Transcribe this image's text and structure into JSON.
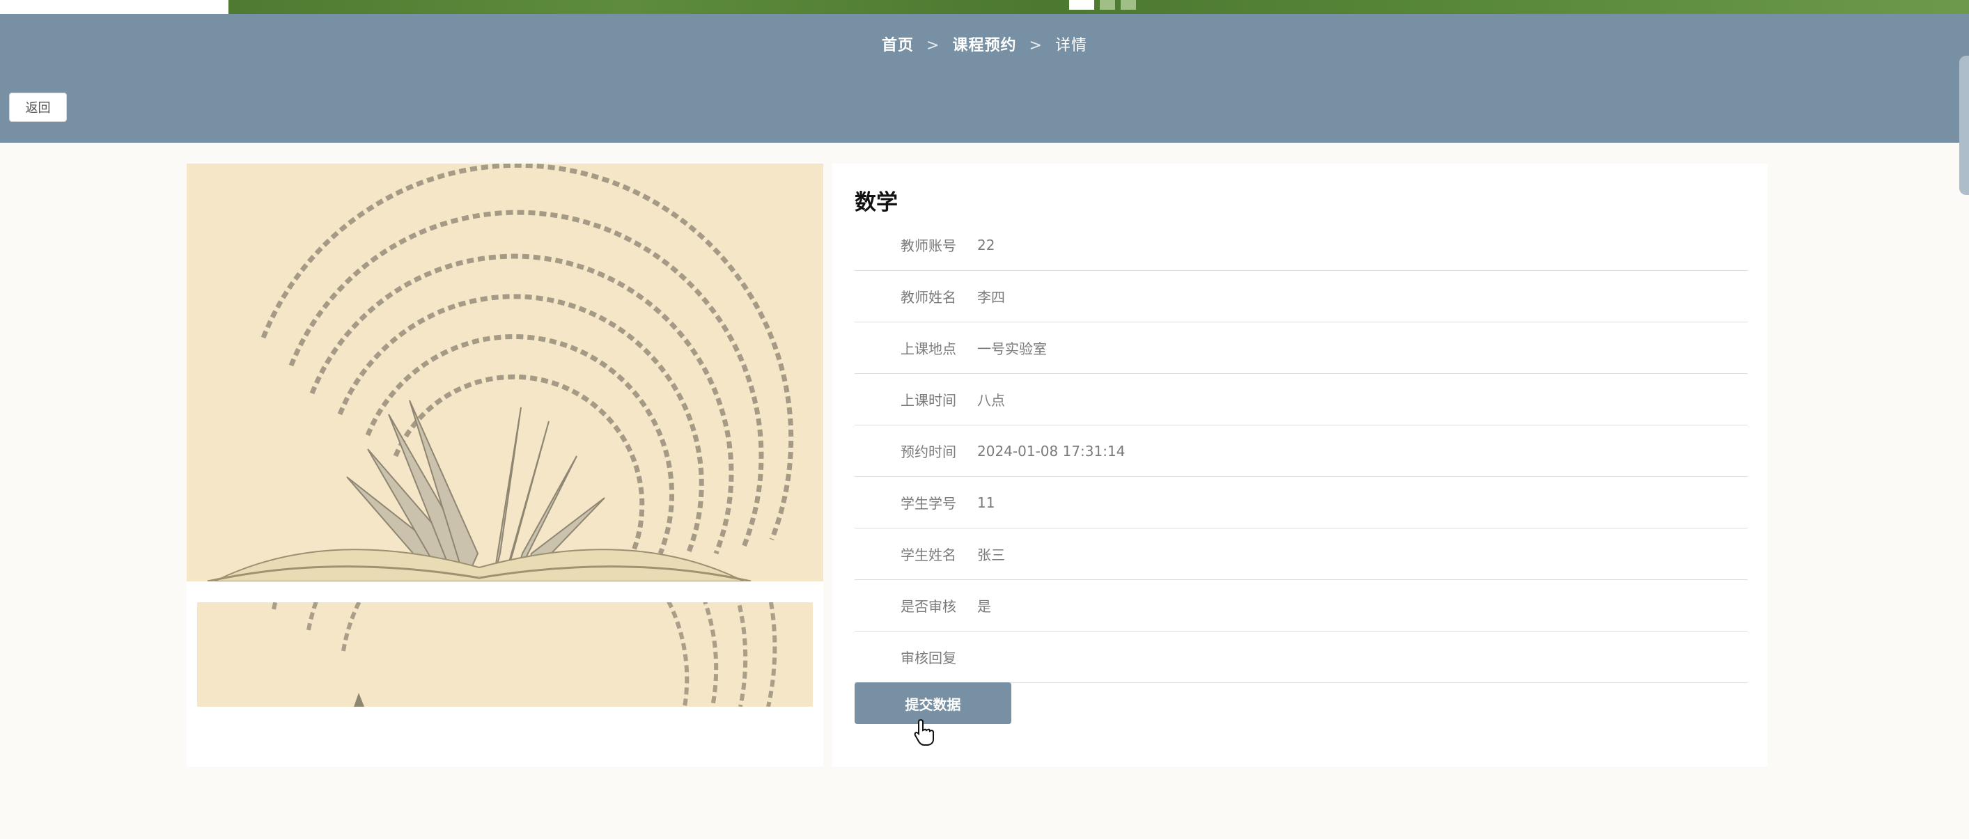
{
  "breadcrumb": {
    "home": "首页",
    "separator": ">",
    "section": "课程预约",
    "current": "详情"
  },
  "back_button": "返回",
  "course": {
    "title": "数学",
    "fields": [
      {
        "label": "教师账号",
        "value": "22"
      },
      {
        "label": "教师姓名",
        "value": "李四"
      },
      {
        "label": "上课地点",
        "value": "一号实验室"
      },
      {
        "label": "上课时间",
        "value": "八点"
      },
      {
        "label": "预约时间",
        "value": "2024-01-08 17:31:14"
      },
      {
        "label": "学生学号",
        "value": "11"
      },
      {
        "label": "学生姓名",
        "value": "张三"
      },
      {
        "label": "是否审核",
        "value": "是"
      },
      {
        "label": "审核回复",
        "value": ""
      }
    ]
  },
  "submit_button": "提交数据",
  "colors": {
    "header": "#7790a3",
    "button": "#7790a3",
    "background": "#fcfaf6"
  },
  "icons": {
    "cursor": "hand-pointer-icon"
  }
}
